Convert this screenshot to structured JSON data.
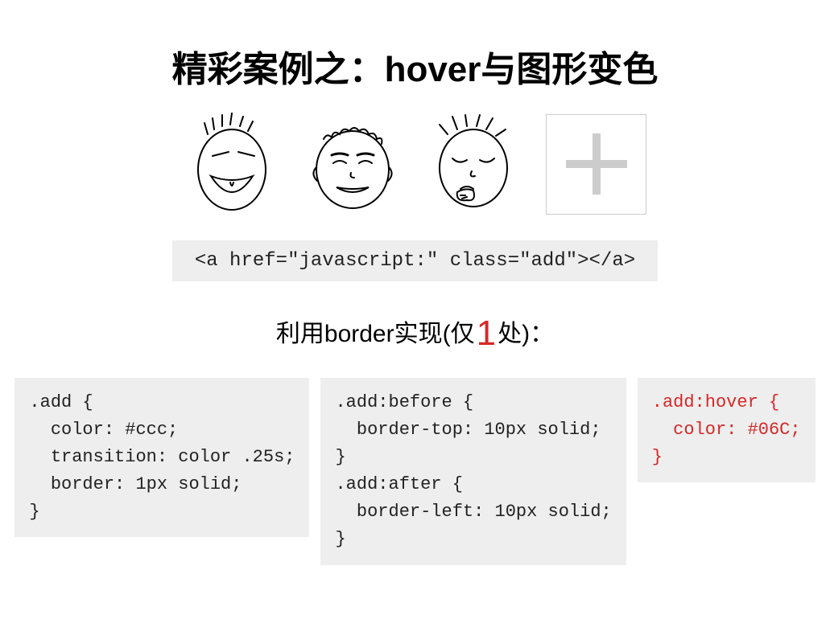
{
  "title": "精彩案例之：hover与图形变色",
  "html_snippet": "<a href=\"javascript:\" class=\"add\"></a>",
  "subtitle_prefix": "利用border实现(仅",
  "subtitle_highlight": "1",
  "subtitle_suffix": "处)：",
  "code_blocks": {
    "block1": ".add {\n  color: #ccc;\n  transition: color .25s;\n  border: 1px solid;\n}",
    "block2": ".add:before {\n  border-top: 10px solid;\n}\n.add:after {\n  border-left: 10px solid;\n}",
    "block3": ".add:hover {\n  color: #06C;\n}"
  },
  "illustration": {
    "faces": [
      "laughing-face",
      "smiling-face",
      "eating-face"
    ],
    "add_button_symbol": "plus"
  }
}
